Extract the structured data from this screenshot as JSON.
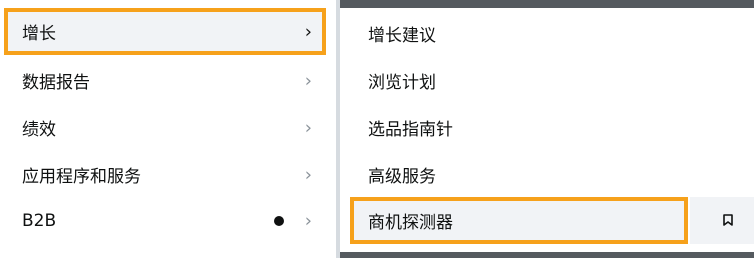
{
  "left_menu": {
    "items": [
      {
        "label": "增长",
        "active": true,
        "has_dot": false
      },
      {
        "label": "数据报告",
        "active": false,
        "has_dot": false
      },
      {
        "label": "绩效",
        "active": false,
        "has_dot": false
      },
      {
        "label": "应用程序和服务",
        "active": false,
        "has_dot": false
      },
      {
        "label": "B2B",
        "active": false,
        "has_dot": true
      }
    ],
    "chevron_icon": "chevron-right-icon",
    "dot_icon": "notification-dot-icon"
  },
  "submenu": {
    "items": [
      {
        "label": "增长建议",
        "active": false
      },
      {
        "label": "浏览计划",
        "active": false
      },
      {
        "label": "选品指南针",
        "active": false
      },
      {
        "label": "高级服务",
        "active": false
      },
      {
        "label": "商机探测器",
        "active": true
      }
    ],
    "bookmark_icon": "bookmark-icon"
  },
  "colors": {
    "accent": "#f6a11b",
    "active_bg": "#f1f3f6",
    "text": "#0f1111",
    "chevron": "#8a9299",
    "divider": "#d6dbe0",
    "dark_bar": "#555a5f"
  }
}
